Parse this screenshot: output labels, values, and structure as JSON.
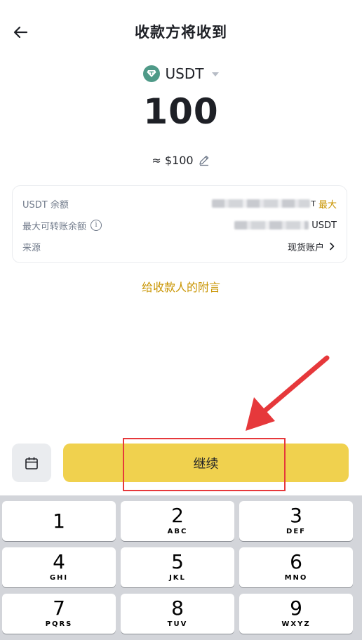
{
  "header": {
    "title": "收款方将收到"
  },
  "coin": {
    "symbol": "USDT"
  },
  "amount": "100",
  "fiat_estimate": "≈ $100",
  "card": {
    "balance_label": "USDT 余额",
    "balance_suffix": "T",
    "max_label": "最大",
    "max_transfer_label": "最大可转账余额",
    "max_transfer_suffix": "USDT",
    "source_label": "来源",
    "source_value": "现货账户"
  },
  "memo_link": "给收款人的附言",
  "continue_label": "继续",
  "colors": {
    "accent": "#f0d14e",
    "accent_text": "#c99400",
    "annotation": "#e6383b",
    "coin": "#4f9a88"
  },
  "icons": [
    "back-arrow-icon",
    "usdt-coin-icon",
    "caret-down-icon",
    "edit-pencil-icon",
    "info-icon",
    "chevron-right-icon",
    "calendar-icon"
  ],
  "keypad": [
    {
      "num": "1",
      "letters": ""
    },
    {
      "num": "2",
      "letters": "ABC"
    },
    {
      "num": "3",
      "letters": "DEF"
    },
    {
      "num": "4",
      "letters": "GHI"
    },
    {
      "num": "5",
      "letters": "JKL"
    },
    {
      "num": "6",
      "letters": "MNO"
    },
    {
      "num": "7",
      "letters": "PQRS"
    },
    {
      "num": "8",
      "letters": "TUV"
    },
    {
      "num": "9",
      "letters": "WXYZ"
    }
  ]
}
